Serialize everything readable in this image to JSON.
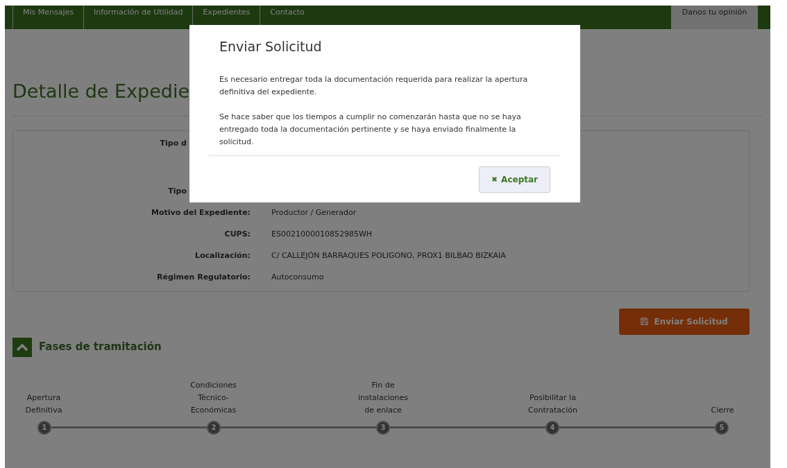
{
  "nav": {
    "items": [
      {
        "label": "Mis Mensajes"
      },
      {
        "label": "Información de Utilidad"
      },
      {
        "label": "Expedientes"
      },
      {
        "label": "Contacto"
      }
    ],
    "feedback": "Danos tu opinión"
  },
  "page_title": "Detalle de Expedie",
  "details": [
    {
      "label": "Tipo d"
    },
    {
      "label": "Tipo"
    },
    {
      "label": "Motivo del Expediente:",
      "value": "Productor / Generador"
    },
    {
      "label": "CUPS:",
      "value": "ES0021000010852985WH"
    },
    {
      "label": "Localización:",
      "value": "C/ CALLEJÓN BARRAQUES POLIGONO, PROX1 BILBAO BIZKAIA"
    },
    {
      "label": "Régimen Regulatorio:",
      "value": "Autoconsumo"
    }
  ],
  "send_button": "Enviar Solicitud",
  "phases": {
    "title": "Fases de tramitación",
    "expanded": true,
    "steps": [
      {
        "label": "Apertura Definitiva",
        "number": "1"
      },
      {
        "label": "Condiciones Técnico-Económicas",
        "number": "2"
      },
      {
        "label": "Fin de instalaciones de enlace",
        "number": "3"
      },
      {
        "label": "Posibilitar la Contratación",
        "number": "4"
      },
      {
        "label": "Cierre",
        "number": "5"
      }
    ]
  },
  "modal": {
    "title": "Enviar Solicitud",
    "paragraphs": [
      "Es necesario entregar toda la documentación requerida para realizar la apertura definitiva del expediente.",
      "Se hace saber que los tiempos a cumplir no comenzarán hasta que no se haya entregado toda la documentación pertinente y se haya enviado finalmente la solicitud."
    ],
    "button": "Aceptar"
  }
}
